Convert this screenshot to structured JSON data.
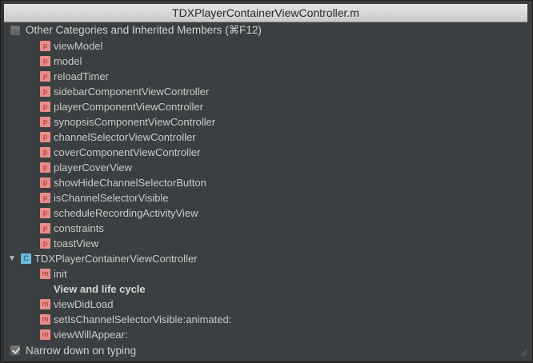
{
  "window": {
    "title": "TDXPlayerContainerViewController.m"
  },
  "header": {
    "label": "Other Categories and Inherited Members (⌘F12)"
  },
  "properties": [
    {
      "badge": "p",
      "label": "viewModel"
    },
    {
      "badge": "p",
      "label": "model"
    },
    {
      "badge": "p",
      "label": "reloadTimer"
    },
    {
      "badge": "p",
      "label": "sidebarComponentViewController"
    },
    {
      "badge": "p",
      "label": "playerComponentViewController"
    },
    {
      "badge": "p",
      "label": "synopsisComponentViewController"
    },
    {
      "badge": "p",
      "label": "channelSelectorViewController"
    },
    {
      "badge": "p",
      "label": "coverComponentViewController"
    },
    {
      "badge": "p",
      "label": "playerCoverView"
    },
    {
      "badge": "p",
      "label": "showHideChannelSelectorButton"
    },
    {
      "badge": "p",
      "label": "isChannelSelectorVisible"
    },
    {
      "badge": "p",
      "label": "scheduleRecordingActivityView"
    },
    {
      "badge": "p",
      "label": "constraints"
    },
    {
      "badge": "p",
      "label": "toastView"
    }
  ],
  "class_node": {
    "arrow": "▼",
    "badge": "C",
    "label": "TDXPlayerContainerViewController"
  },
  "methods": [
    {
      "type": "method",
      "badge": "m",
      "label": "init"
    },
    {
      "type": "section",
      "label": "View and life cycle"
    },
    {
      "type": "method",
      "badge": "m",
      "label": "viewDidLoad"
    },
    {
      "type": "method",
      "badge": "m",
      "label": "setIsChannelSelectorVisible:animated:"
    },
    {
      "type": "method",
      "badge": "m",
      "label": "viewWillAppear:"
    }
  ],
  "footer": {
    "label": "Narrow down on typing"
  }
}
